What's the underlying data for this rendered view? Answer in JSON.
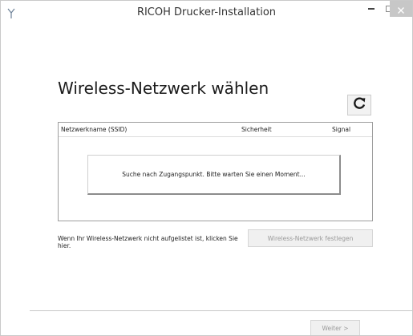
{
  "window": {
    "title": "RICOH Drucker-Installation",
    "app_icon": "installer-icon",
    "controls": {
      "minimize_icon": "minimize-icon",
      "maximize_icon": "maximize-icon",
      "close_icon": "close-icon"
    }
  },
  "page": {
    "heading": "Wireless-Netzwerk wählen",
    "refresh_icon": "refresh-icon"
  },
  "table": {
    "columns": [
      "Netzwerkname (SSID)",
      "Sicherheit",
      "Signal"
    ],
    "rows": [],
    "searching_message": "Suche nach Zugangspunkt. Bitte warten Sie einen Moment..."
  },
  "hint": {
    "text": "Wenn Ihr Wireless-Netzwerk nicht aufgelistet ist, klicken Sie hier."
  },
  "buttons": {
    "set_network": "Wireless-Netzwerk festlegen",
    "next": "Weiter >"
  },
  "colors": {
    "background": "#ffffff",
    "disabled_text": "#9a9a9a",
    "close_button": "#c7c7c7"
  }
}
